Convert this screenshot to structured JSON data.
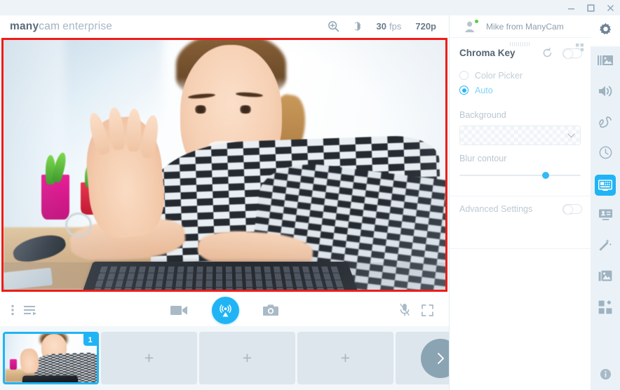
{
  "window": {
    "minimize_label": "minimize",
    "maximize_label": "maximize",
    "close_label": "close"
  },
  "header": {
    "logo_bold": "many",
    "logo_light": "cam",
    "logo_edition": "enterprise",
    "zoom_icon": "magnifier-plus-icon",
    "brightness_icon": "brightness-icon",
    "fps_value": "30",
    "fps_unit": "fps",
    "resolution": "720p"
  },
  "account": {
    "name": "Mike from ManyCam",
    "avatar_icon": "user-avatar-icon",
    "status": "online"
  },
  "video": {
    "label": "live-preview",
    "border_color": "#ee1c18"
  },
  "controls": {
    "menu_icon": "kebab-menu-icon",
    "playlist_icon": "playlist-icon",
    "record_icon": "video-camera-icon",
    "broadcast_icon": "broadcast-icon",
    "snapshot_icon": "camera-icon",
    "mic_icon": "microphone-muted-icon",
    "fullscreen_icon": "fullscreen-icon",
    "broadcast_color": "#20b4f5"
  },
  "thumbnails": {
    "items": [
      {
        "type": "preset",
        "badge": "1",
        "active": true,
        "plus": ""
      },
      {
        "type": "add",
        "badge": "",
        "active": false,
        "plus": "+"
      },
      {
        "type": "add",
        "badge": "",
        "active": false,
        "plus": "+"
      },
      {
        "type": "add",
        "badge": "",
        "active": false,
        "plus": "+"
      },
      {
        "type": "add",
        "badge": "",
        "active": false,
        "plus": "+"
      }
    ],
    "next_icon": "chevron-right-icon"
  },
  "panel": {
    "title": "Chroma Key",
    "reset_icon": "reset-icon",
    "enable_toggle": "off",
    "grid_icon": "grid-icon",
    "drag_handle_icon": "drag-handle-icon",
    "options": [
      {
        "label": "Color Picker",
        "selected": false
      },
      {
        "label": "Auto",
        "selected": true
      }
    ],
    "background_label": "Background",
    "background_value": "transparent",
    "background_chevron_icon": "chevron-down-icon",
    "blur_label": "Blur contour",
    "blur_value": 71,
    "advanced_label": "Advanced Settings",
    "advanced_toggle": "off",
    "accent_color": "#20b4f5"
  },
  "rail": {
    "items": [
      {
        "name": "settings",
        "icon": "gear-icon",
        "active": false,
        "highlight": "white"
      },
      {
        "name": "presets",
        "icon": "presets-icon",
        "active": false,
        "highlight": ""
      },
      {
        "name": "audio",
        "icon": "speaker-icon",
        "active": false,
        "highlight": ""
      },
      {
        "name": "draw",
        "icon": "scribble-icon",
        "active": false,
        "highlight": ""
      },
      {
        "name": "history",
        "icon": "clock-icon",
        "active": false,
        "highlight": ""
      },
      {
        "name": "chroma-key",
        "icon": "chroma-key-icon",
        "active": true,
        "highlight": ""
      },
      {
        "name": "lower-third",
        "icon": "lower-third-icon",
        "active": false,
        "highlight": ""
      },
      {
        "name": "effects",
        "icon": "magic-wand-icon",
        "active": false,
        "highlight": ""
      },
      {
        "name": "backgrounds",
        "icon": "image-stack-icon",
        "active": false,
        "highlight": ""
      },
      {
        "name": "objects",
        "icon": "objects-grid-icon",
        "active": false,
        "highlight": ""
      }
    ],
    "info": {
      "name": "info",
      "icon": "info-icon"
    }
  }
}
